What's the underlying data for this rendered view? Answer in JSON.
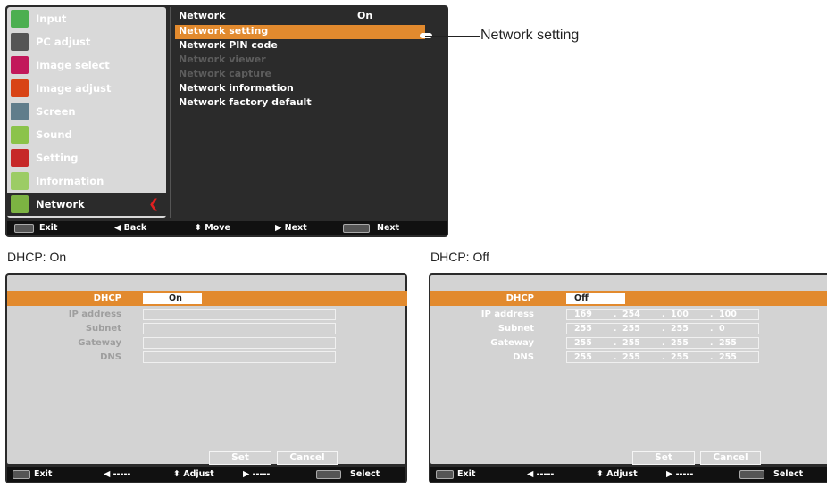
{
  "top_menu": {
    "sidebar": [
      {
        "label": "Input",
        "icon": "input-icon",
        "color": "#4caf50"
      },
      {
        "label": "PC adjust",
        "icon": "pc-adjust-icon",
        "color": "#555555"
      },
      {
        "label": "Image select",
        "icon": "image-select-icon",
        "color": "#c2185b"
      },
      {
        "label": "Image adjust",
        "icon": "image-adjust-icon",
        "color": "#d84315"
      },
      {
        "label": "Screen",
        "icon": "screen-icon",
        "color": "#607d8b"
      },
      {
        "label": "Sound",
        "icon": "sound-icon",
        "color": "#8bc34a"
      },
      {
        "label": "Setting",
        "icon": "setting-icon",
        "color": "#c62828"
      },
      {
        "label": "Information",
        "icon": "information-icon",
        "color": "#9ccc65"
      },
      {
        "label": "Network",
        "icon": "network-icon",
        "color": "#7cb342"
      }
    ],
    "selected_index": 8,
    "submenu": {
      "network_label": "Network",
      "network_value": "On",
      "items": [
        {
          "label": "Network setting",
          "enabled": true
        },
        {
          "label": "Network PIN code",
          "enabled": true
        },
        {
          "label": "Network viewer",
          "enabled": false
        },
        {
          "label": "Network capture",
          "enabled": false
        },
        {
          "label": "Network information",
          "enabled": true
        },
        {
          "label": "Network factory default",
          "enabled": true
        }
      ]
    },
    "status_bar": {
      "menu_key": "MENU",
      "exit": "Exit",
      "back": "◀ Back",
      "move": "⬍ Move",
      "next": "▶ Next",
      "select_key": "SELECT",
      "select_next": "Next"
    }
  },
  "callout": {
    "label": "Network setting"
  },
  "captions": {
    "on": "DHCP: On",
    "off": "DHCP: Off"
  },
  "dhcp_on": {
    "dhcp_label": "DHCP",
    "dhcp_value": "On",
    "rows": [
      "IP address",
      "Subnet",
      "Gateway",
      "DNS"
    ],
    "set": "Set",
    "cancel": "Cancel"
  },
  "dhcp_off": {
    "dhcp_label": "DHCP",
    "dhcp_value": "Off",
    "rows": [
      {
        "label": "IP address",
        "values": [
          "169",
          "254",
          "100",
          "100"
        ]
      },
      {
        "label": "Subnet",
        "values": [
          "255",
          "255",
          "255",
          "0"
        ]
      },
      {
        "label": "Gateway",
        "values": [
          "255",
          "255",
          "255",
          "255"
        ]
      },
      {
        "label": "DNS",
        "values": [
          "255",
          "255",
          "255",
          "255"
        ]
      }
    ],
    "set": "Set",
    "cancel": "Cancel"
  },
  "bottom_status": {
    "menu_key": "MENU",
    "exit": "Exit",
    "left": "◀ -----",
    "adjust": "⬍ Adjust",
    "right": "▶ -----",
    "select_key": "SELECT",
    "select": "Select"
  },
  "colors": {
    "highlight": "#e28a2e",
    "panel": "#2b2b2b",
    "panel_inner": "#d3d3d3",
    "chevron": "#e02020"
  }
}
